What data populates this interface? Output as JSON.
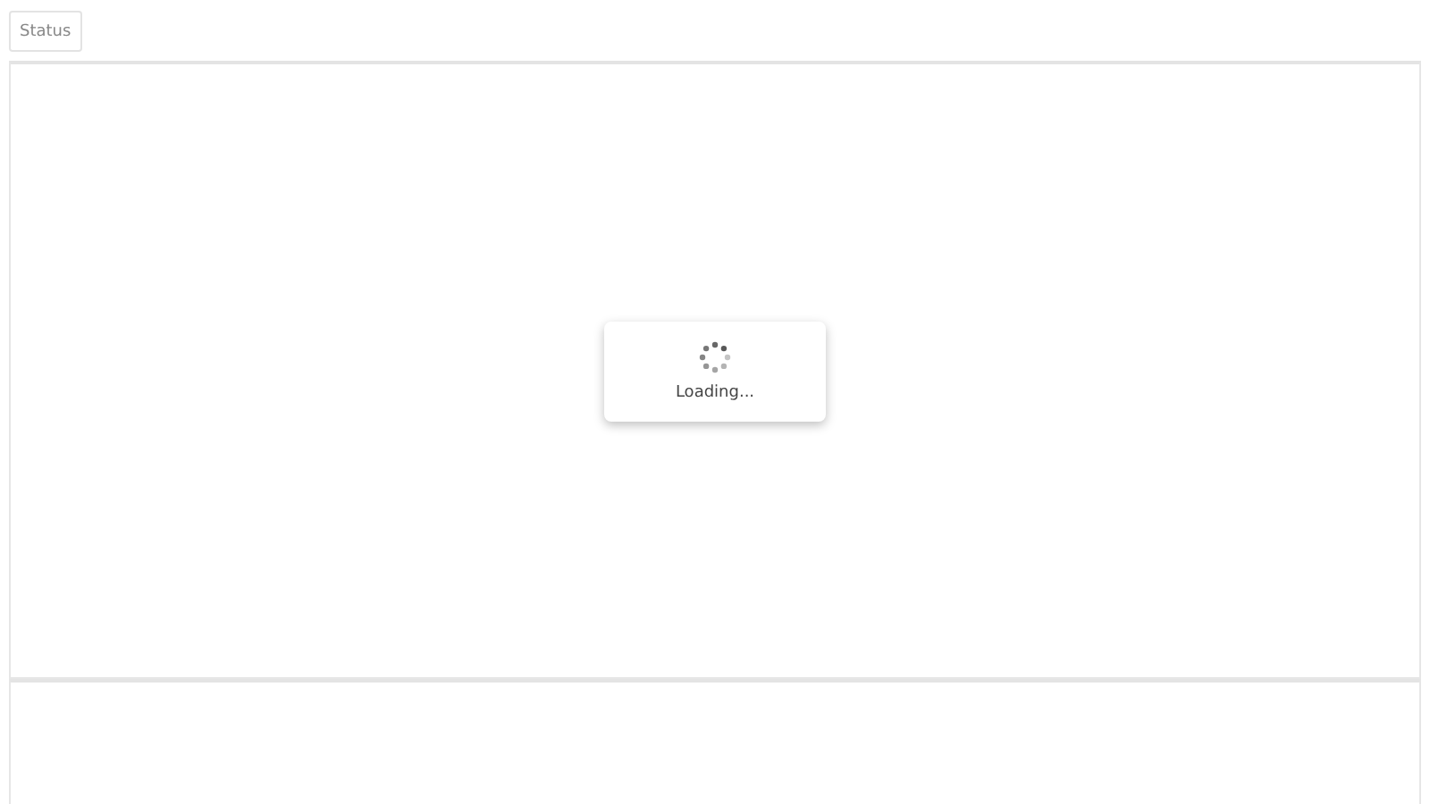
{
  "toolbar": {
    "status_button": "Status"
  },
  "loading": {
    "message": "Loading..."
  }
}
